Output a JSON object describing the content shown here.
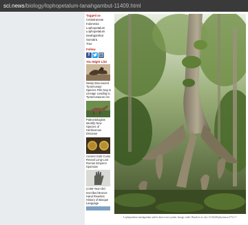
{
  "browser": {
    "url_host": "sci.news",
    "url_path": "/biology/lophopetalum-tanahgambut-11409.html"
  },
  "sidebar": {
    "tagged_as_heading": "Tagged as",
    "tags": [
      "Celastraceae",
      "Indonesia",
      "Lophopetalum",
      "Lophopetalum",
      "tanahgambut",
      "Sumatra",
      "Tree"
    ],
    "follow_heading": "Follow",
    "social_icons": [
      "facebook-icon",
      "twitter-icon",
      "email-icon"
    ],
    "you_might_like_heading": "You Might Like",
    "stories": [
      {
        "title": "Newly-Discovered Tyrannosaur Species Fills Gap in Lineage Leading to Tyrannosaurus rex"
      },
      {
        "title": "Paleontologists Identify New Species of Herbivorous Dinosaur"
      },
      {
        "title": "Ancient Gold Coins Reveal Long-Lost Roman Emperor Sponsian"
      },
      {
        "title": "2,000-Year-Old Inscribed Bronze Hand Rewrites History of Basque Language"
      }
    ]
  },
  "main": {
    "caption": "Lophopetalum tanahgambut and its knee roots system. Image credit: Randi et al., doi: 10.26245/phytotaxa.573.1.7."
  },
  "colors": {
    "accent": "#b3261e",
    "page_bg": "#e9ecef",
    "url_bar_bg": "#3a3a3a"
  }
}
